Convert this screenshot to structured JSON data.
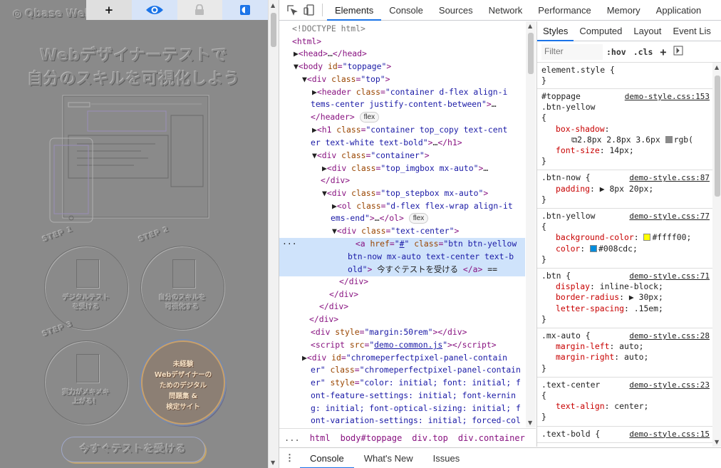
{
  "preview": {
    "logo": "Qbase Web",
    "title_line1": "Webデザイナーテストで",
    "title_line2": "自分のスキルを可視化しよう",
    "steps": [
      {
        "label": "STEP 1",
        "text1": "デジタルテスト",
        "text2": "を受ける"
      },
      {
        "label": "STEP 2",
        "text1": "自分のスキルを",
        "text2": "可視化する"
      },
      {
        "label": "STEP 3",
        "text1": "実力がメキメキ",
        "text2": "上がる！"
      }
    ],
    "badge": {
      "line1": "未経験",
      "line2": "Webデザイナーの",
      "line3": "ためのデジタル",
      "line4": "問題集 &",
      "line5": "検定サイト"
    },
    "cta": "今すぐテストを受ける",
    "toolbar": {
      "plus": "+"
    }
  },
  "devtools": {
    "tabs": [
      "Elements",
      "Console",
      "Sources",
      "Network",
      "Performance",
      "Memory",
      "Application"
    ],
    "active_tab": "Elements",
    "breadcrumb": [
      "...",
      "html",
      "body#toppage",
      "div.top",
      "div.container",
      "‹"
    ],
    "styles_tabs": [
      "Styles",
      "Computed",
      "Layout",
      "Event Lis"
    ],
    "filter_placeholder": "Filter",
    "filter_buttons": [
      ":hov",
      ".cls",
      "+"
    ],
    "drawer_tabs": [
      "Console",
      "What's New",
      "Issues"
    ]
  },
  "styles": {
    "element_style": "element.style {",
    "r1_sel1": "#toppage",
    "r1_sel2": ".btn-yellow",
    "r1_src": "demo-style.css:153",
    "r1_p1": "box-shadow",
    "r1_v1": "2.8px 2.8px 3.6px",
    "r1_v1b": "rgb(",
    "r1_p2": "font-size",
    "r1_v2": "14px;",
    "r2_sel": ".btn-now {",
    "r2_src": "demo-style.css:87",
    "r2_p1": "padding",
    "r2_v1": "8px 20px;",
    "r3_sel": ".btn-yellow",
    "r3_src": "demo-style.css:77",
    "r3_p1": "background-color",
    "r3_v1": "#ffff00;",
    "r3_p2": "color",
    "r3_v2": "#008cdc;",
    "r4_sel": ".btn {",
    "r4_src": "demo-style.css:71",
    "r4_p1": "display",
    "r4_v1": "inline-block;",
    "r4_p2": "border-radius",
    "r4_v2": "30px;",
    "r4_p3": "letter-spacing",
    "r4_v3": ".15em;",
    "r5_sel": ".mx-auto {",
    "r5_src": "demo-style.css:28",
    "r5_p1": "margin-left",
    "r5_v1": "auto;",
    "r5_p2": "margin-right",
    "r5_v2": "auto;",
    "r6_sel": ".text-center",
    "r6_src": "demo-style.css:23",
    "r6_p1": "text-align",
    "r6_v1": "center;",
    "r7_sel": ".text-bold {",
    "r7_src": "demo-style.css:15",
    "colors": {
      "yellow": "#ffff00",
      "blue": "#008cdc"
    }
  }
}
